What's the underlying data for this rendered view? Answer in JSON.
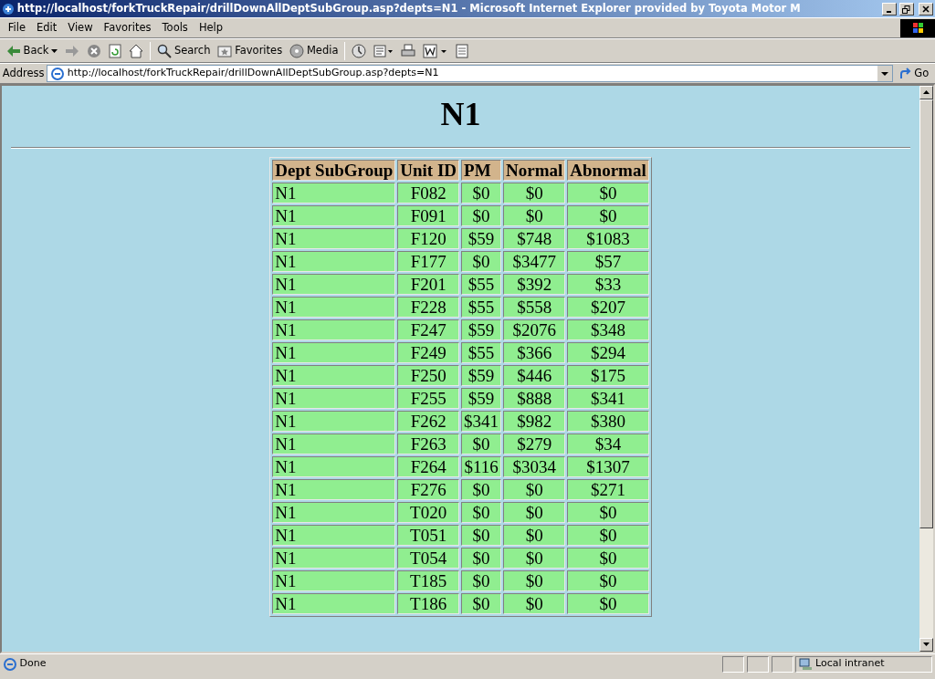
{
  "window": {
    "title": "http://localhost/forkTruckRepair/drillDownAllDeptSubGroup.asp?depts=N1 - Microsoft Internet Explorer provided by Toyota Motor M"
  },
  "menu": [
    "File",
    "Edit",
    "View",
    "Favorites",
    "Tools",
    "Help"
  ],
  "toolbar": [
    {
      "kind": "back",
      "label": "Back"
    },
    {
      "kind": "forward"
    },
    {
      "kind": "stop"
    },
    {
      "kind": "refresh"
    },
    {
      "kind": "home"
    },
    {
      "kind": "search",
      "label": "Search"
    },
    {
      "kind": "favorites",
      "label": "Favorites"
    },
    {
      "kind": "media",
      "label": "Media"
    },
    {
      "kind": "history"
    },
    {
      "kind": "mail"
    },
    {
      "kind": "print"
    },
    {
      "kind": "edit"
    },
    {
      "kind": "discuss"
    }
  ],
  "address": {
    "label": "Address",
    "value": "http://localhost/forkTruckRepair/drillDownAllDeptSubGroup.asp?depts=N1",
    "go": "Go"
  },
  "page": {
    "heading": "N1",
    "table": {
      "columns": [
        "Dept SubGroup",
        "Unit ID",
        "PM",
        "Normal",
        "Abnormal"
      ],
      "rows": [
        [
          "N1",
          "F082",
          "$0",
          "$0",
          "$0"
        ],
        [
          "N1",
          "F091",
          "$0",
          "$0",
          "$0"
        ],
        [
          "N1",
          "F120",
          "$59",
          "$748",
          "$1083"
        ],
        [
          "N1",
          "F177",
          "$0",
          "$3477",
          "$57"
        ],
        [
          "N1",
          "F201",
          "$55",
          "$392",
          "$33"
        ],
        [
          "N1",
          "F228",
          "$55",
          "$558",
          "$207"
        ],
        [
          "N1",
          "F247",
          "$59",
          "$2076",
          "$348"
        ],
        [
          "N1",
          "F249",
          "$55",
          "$366",
          "$294"
        ],
        [
          "N1",
          "F250",
          "$59",
          "$446",
          "$175"
        ],
        [
          "N1",
          "F255",
          "$59",
          "$888",
          "$341"
        ],
        [
          "N1",
          "F262",
          "$341",
          "$982",
          "$380"
        ],
        [
          "N1",
          "F263",
          "$0",
          "$279",
          "$34"
        ],
        [
          "N1",
          "F264",
          "$116",
          "$3034",
          "$1307"
        ],
        [
          "N1",
          "F276",
          "$0",
          "$0",
          "$271"
        ],
        [
          "N1",
          "T020",
          "$0",
          "$0",
          "$0"
        ],
        [
          "N1",
          "T051",
          "$0",
          "$0",
          "$0"
        ],
        [
          "N1",
          "T054",
          "$0",
          "$0",
          "$0"
        ],
        [
          "N1",
          "T185",
          "$0",
          "$0",
          "$0"
        ],
        [
          "N1",
          "T186",
          "$0",
          "$0",
          "$0"
        ]
      ]
    }
  },
  "status_bar": {
    "text": "Done",
    "zone": "Local intranet"
  }
}
